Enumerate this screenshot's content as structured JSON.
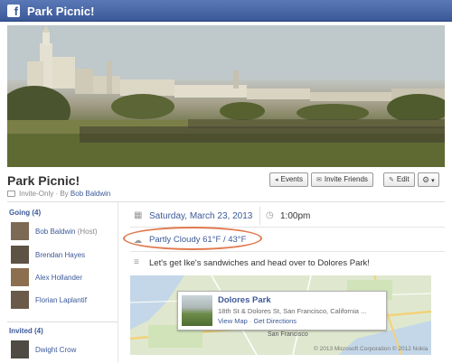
{
  "topbar": {
    "logo": "f",
    "title": "Park Picnic!"
  },
  "event": {
    "title": "Park Picnic!",
    "privacy": "Invite-Only",
    "by_prefix": " · By ",
    "host_name": "Bob Baldwin"
  },
  "actions": {
    "events": "Events",
    "invite": "Invite Friends",
    "edit": "Edit"
  },
  "sidebar": {
    "going_header": "Going (4)",
    "going": [
      {
        "name": "Bob Baldwin",
        "tag": " (Host)"
      },
      {
        "name": "Brendan Hayes"
      },
      {
        "name": "Alex Hollander"
      },
      {
        "name": "Florian Laplantif"
      }
    ],
    "invited_header": "Invited (4)",
    "invited": [
      {
        "name": "Dwight Crow"
      }
    ]
  },
  "details": {
    "date": "Saturday, March 23, 2013",
    "time": "1:00pm",
    "weather": "Partly Cloudy 61°F / 43°F",
    "description": "Let's get Ike's sandwiches and head over to Dolores Park!"
  },
  "map": {
    "place_name": "Dolores Park",
    "address": "18th St & Dolores St, San Francisco, California ...",
    "view_map": "View Map",
    "separator": " · ",
    "directions": "Get Directions",
    "label_sf": "San Francisco",
    "copyright": "© 2013 Microsoft Corporation © 2012 Nokia"
  },
  "colors": {
    "brand": "#3b5998",
    "highlight": "#e07a4f"
  },
  "icons": [
    "facebook-logo",
    "lock-icon",
    "calendar-icon",
    "clock-icon",
    "cloud-icon",
    "description-icon",
    "gear-icon",
    "pencil-icon",
    "envelope-icon",
    "back-arrow-icon"
  ]
}
